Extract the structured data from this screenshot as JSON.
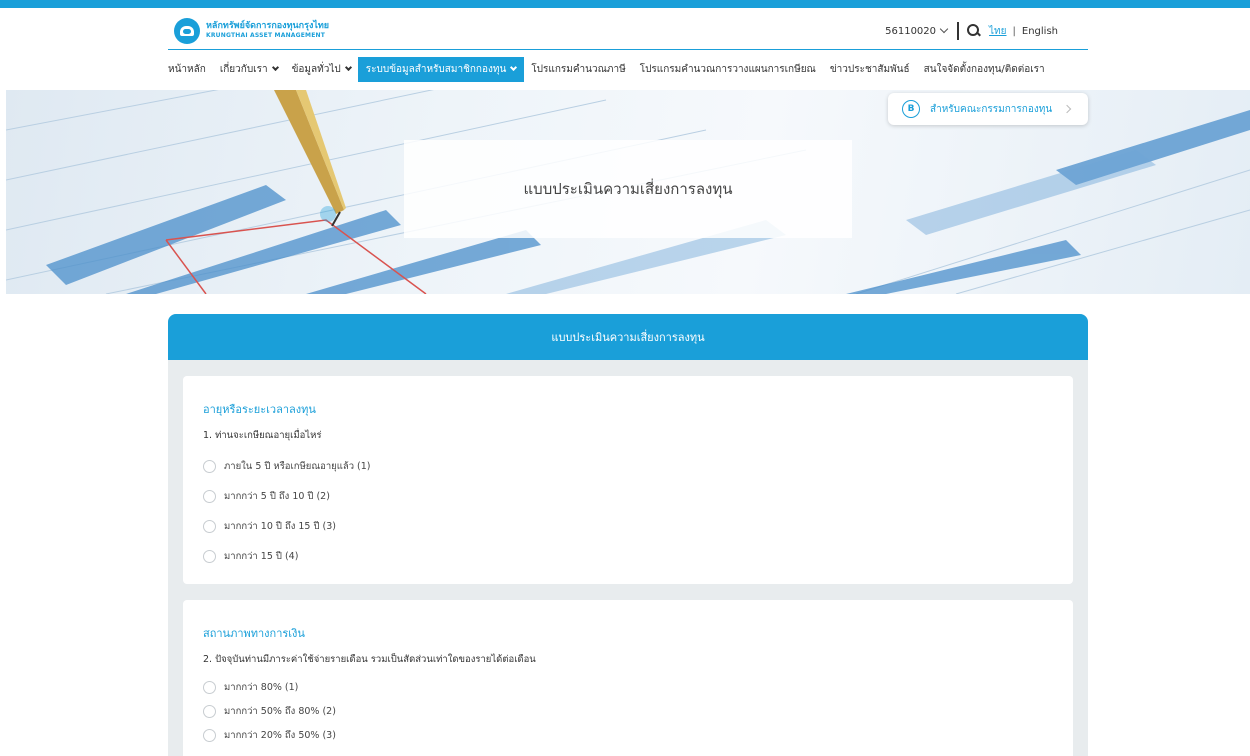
{
  "header": {
    "logo_th": "หลักทรัพย์จัดการกองทุนกรุงไทย",
    "logo_en": "KRUNGTHAI ASSET MANAGEMENT",
    "user_id": "56110020",
    "lang_th": "ไทย",
    "lang_sep": "|",
    "lang_en": "English"
  },
  "nav": {
    "items": [
      {
        "label": "หน้าหลัก"
      },
      {
        "label": "เกี่ยวกับเรา"
      },
      {
        "label": "ข้อมูลทั่วไป"
      },
      {
        "label": "ระบบข้อมูลสำหรับสมาชิกกองทุน"
      },
      {
        "label": "โปรแกรมคำนวณภาษี"
      },
      {
        "label": "โปรแกรมคำนวณการวางแผนการเกษียณ"
      },
      {
        "label": "ข่าวประชาสัมพันธ์"
      },
      {
        "label": "สนใจจัดตั้งกองทุน/ติดต่อเรา"
      }
    ]
  },
  "banner": {
    "title": "แบบประเมินความเสี่ยงการลงทุน",
    "committee_label": "สำหรับคณะกรรมการกองทุน",
    "committee_icon_letter": "B"
  },
  "form": {
    "header": "แบบประเมินความเสี่ยงการลงทุน",
    "sections": [
      {
        "title": "อายุหรือระยะเวลาลงทุน",
        "question": "1. ท่านจะเกษียณอายุเมื่อไหร่",
        "options": [
          "ภายใน 5 ปี หรือเกษียณอายุแล้ว (1)",
          "มากกว่า 5 ปี ถึง 10 ปี (2)",
          "มากกว่า 10 ปี ถึง 15 ปี (3)",
          "มากกว่า 15 ปี (4)"
        ]
      },
      {
        "title": "สถานภาพทางการเงิน",
        "question": "2. ปัจจุบันท่านมีภาระค่าใช้จ่ายรายเดือน รวมเป็นสัดส่วนเท่าใดของรายได้ต่อเดือน",
        "options": [
          "มากกว่า 80% (1)",
          "มากกว่า 50% ถึง 80% (2)",
          "มากกว่า 20% ถึง 50% (3)"
        ]
      }
    ]
  },
  "colors": {
    "accent": "#1a9fd9",
    "form_bg": "#e8ecee"
  }
}
